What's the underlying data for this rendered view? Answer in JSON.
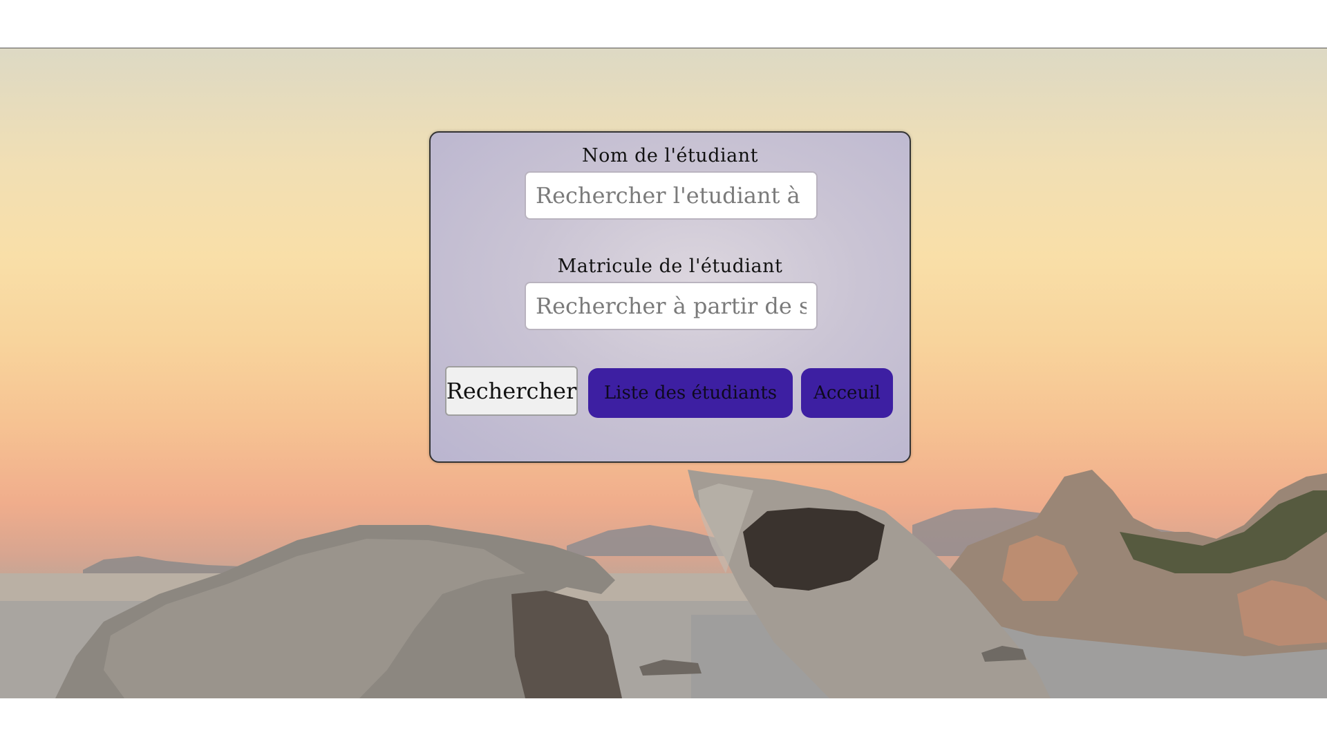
{
  "form": {
    "name_label": "Nom de l'étudiant",
    "name_placeholder": "Rechercher l'etudiant à partir de son nom",
    "matricule_label": "Matricule de l'étudiant",
    "matricule_placeholder": "Rechercher à partir de son matricule"
  },
  "buttons": {
    "search_label": "Rechercher",
    "student_list_label": "Liste des étudiants",
    "home_label": "Acceuil"
  },
  "colors": {
    "primary_button": "#3d1fa2",
    "secondary_button": "#f0f0f0",
    "card_background": "#c9c4d6"
  }
}
